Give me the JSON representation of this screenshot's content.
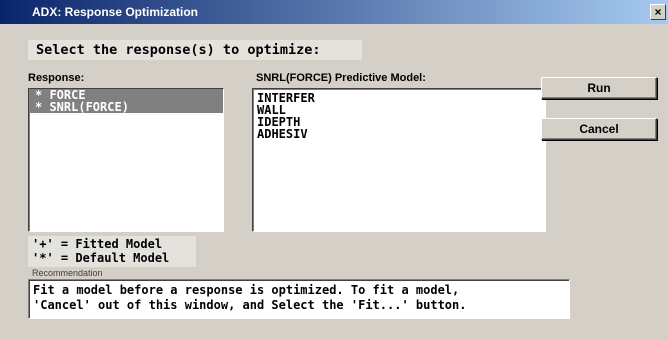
{
  "window": {
    "title": "ADX: Response Optimization",
    "close_glyph": "×"
  },
  "prompt": "Select the response(s) to optimize:",
  "response_list": {
    "label": "Response:",
    "items": [
      {
        "text": "* FORCE",
        "selected": true
      },
      {
        "text": "* SNRL(FORCE)",
        "selected": true
      }
    ]
  },
  "model_list": {
    "label": "SNRL(FORCE) Predictive Model:",
    "items": [
      "INTERFER",
      "WALL",
      "IDEPTH",
      "ADHESIV"
    ]
  },
  "buttons": {
    "run": "Run",
    "cancel": "Cancel"
  },
  "legend": {
    "fitted": "'+' = Fitted Model",
    "default": "'*' = Default Model"
  },
  "recommendation": {
    "label": "Recommendation",
    "line1": "Fit a model before a response is optimized. To fit a model,",
    "line2": "'Cancel' out of this window, and Select the 'Fit...' button."
  },
  "colors": {
    "title_start": "#0a246a",
    "title_end": "#a6caf0",
    "face": "#d4d0c8",
    "selection": "#808080"
  }
}
